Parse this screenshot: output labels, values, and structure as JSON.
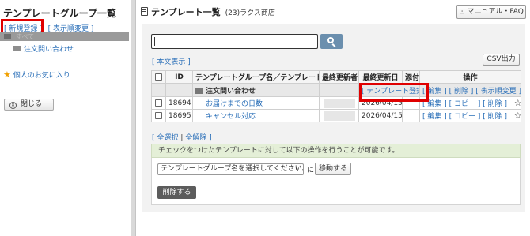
{
  "left": {
    "title": "テンプレートグループ一覧",
    "new_link": "[ 新規登録 ]",
    "order_link": "[ 表示順変更 ]",
    "tree_all": "すべて",
    "tree_child": "注文問い合わせ",
    "favorites": "個人のお気に入り",
    "close_btn": "閉じる"
  },
  "header": {
    "title": "テンプレート一覧",
    "company": "(23)ラクス商店",
    "manual_btn": "マニュアル・FAQ"
  },
  "toolbar": {
    "search_placeholder": "",
    "body_toggle": "[ 本文表示 ]",
    "csv_btn": "CSV出力"
  },
  "table": {
    "headers": {
      "id": "ID",
      "name": "テンプレートグループ名／テンプレート名",
      "updater": "最終更新者",
      "date": "最終更新日",
      "attach": "添付",
      "ops": "操作"
    },
    "group": {
      "name": "注文問い合わせ",
      "register": "[ テンプレート登録 ]",
      "edit": "[ 編集 ]",
      "delete": "[ 削除 ]",
      "order": "[ 表示順変更 ]"
    },
    "rows": [
      {
        "id": "18694",
        "name": "お届けまでの日数",
        "date": "2026/04/15",
        "edit": "[ 編集 ]",
        "copy": "[ コピー ]",
        "delete": "[ 削除 ]"
      },
      {
        "id": "18695",
        "name": "キャンセル対応",
        "date": "2026/04/15",
        "edit": "[ 編集 ]",
        "copy": "[ コピー ]",
        "delete": "[ 削除 ]"
      }
    ]
  },
  "selection": {
    "select_all": "[ 全選択",
    "sep": "|",
    "deselect_all": "全解除 ]"
  },
  "bulk": {
    "notice": "チェックをつけたテンプレートに対して以下の操作を行うことが可能です。",
    "select_value": "テンプレートグループ名を選択してください。",
    "ni": "に",
    "move_btn": "移動する",
    "delete_btn": "削除する"
  },
  "colors": {
    "highlight": "#e00000",
    "link": "#2a6fb8",
    "notice_bg": "#e4efd7",
    "search_btn": "#6b8fae"
  }
}
